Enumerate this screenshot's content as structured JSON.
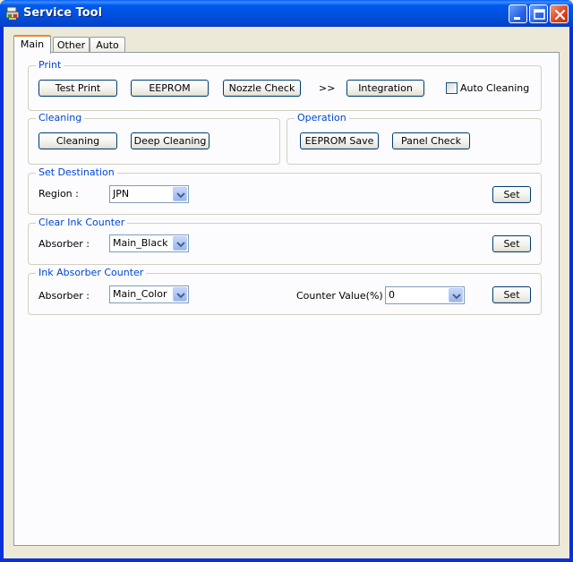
{
  "window": {
    "title": "Service Tool",
    "app_icon": "service-tool-icon"
  },
  "tabs": [
    {
      "label": "Main",
      "active": true
    },
    {
      "label": "Other",
      "active": false
    },
    {
      "label": "Auto",
      "active": false
    }
  ],
  "print": {
    "legend": "Print",
    "test_print": "Test Print",
    "eeprom": "EEPROM",
    "nozzle_check": "Nozzle Check",
    "arrow": ">>",
    "integration": "Integration",
    "auto_cleaning": "Auto Cleaning",
    "auto_cleaning_checked": false
  },
  "cleaning": {
    "legend": "Cleaning",
    "cleaning": "Cleaning",
    "deep_cleaning": "Deep Cleaning"
  },
  "operation": {
    "legend": "Operation",
    "eeprom_save": "EEPROM Save",
    "panel_check": "Panel Check"
  },
  "set_destination": {
    "legend": "Set Destination",
    "region_label": "Region :",
    "region_value": "JPN",
    "set": "Set"
  },
  "clear_ink_counter": {
    "legend": "Clear Ink Counter",
    "absorber_label": "Absorber :",
    "absorber_value": "Main_Black",
    "set": "Set"
  },
  "ink_absorber_counter": {
    "legend": "Ink Absorber Counter",
    "absorber_label": "Absorber :",
    "absorber_value": "Main_Color",
    "counter_label": "Counter Value(%) :",
    "counter_value": "0",
    "set": "Set"
  },
  "colors": {
    "title_bar": "#0058ee",
    "legend_text": "#0046d5",
    "tab_accent": "#e68b2c",
    "close_button": "#e0461f"
  }
}
